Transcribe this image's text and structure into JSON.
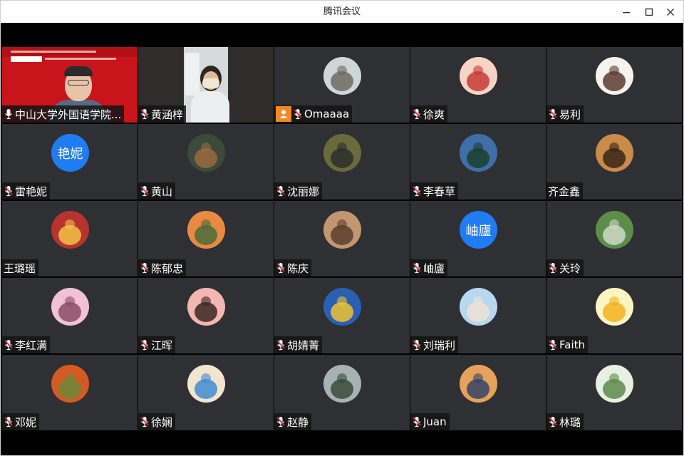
{
  "window": {
    "title": "腾讯会议"
  },
  "participants": [
    {
      "name": "中山大学外国语学院...",
      "type": "video-speaker",
      "muted": false
    },
    {
      "name": "黄涵梓",
      "type": "video-room",
      "muted": true
    },
    {
      "name": "Omaaaa",
      "type": "avatar",
      "muted": true,
      "host": true,
      "avatar_colors": [
        "#cfd6d8",
        "#6c6b5f"
      ]
    },
    {
      "name": "徐爽",
      "type": "avatar",
      "muted": true,
      "avatar_colors": [
        "#f7d4c5",
        "#c73a36"
      ]
    },
    {
      "name": "易利",
      "type": "avatar",
      "muted": true,
      "avatar_colors": [
        "#f6f3ee",
        "#5a3a2f"
      ]
    },
    {
      "name": "雷艳妮",
      "type": "text-avatar",
      "avatar_text": "艳妮",
      "muted": true
    },
    {
      "name": "黄山",
      "type": "avatar",
      "muted": true,
      "avatar_colors": [
        "#3b4a3a",
        "#9a6a3e"
      ]
    },
    {
      "name": "沈丽娜",
      "type": "avatar",
      "muted": true,
      "avatar_colors": [
        "#6b6a3c",
        "#2a2f29"
      ]
    },
    {
      "name": "李春草",
      "type": "avatar",
      "muted": true,
      "avatar_colors": [
        "#3f6ea8",
        "#1b3f2e"
      ]
    },
    {
      "name": "齐金鑫",
      "type": "avatar",
      "muted": false,
      "avatar_colors": [
        "#c98a4a",
        "#3a2417"
      ]
    },
    {
      "name": "王璐瑶",
      "type": "avatar",
      "muted": false,
      "avatar_colors": [
        "#b6332f",
        "#f3c245"
      ]
    },
    {
      "name": "陈郁忠",
      "type": "avatar",
      "muted": true,
      "avatar_colors": [
        "#e98a43",
        "#4a6b3a"
      ]
    },
    {
      "name": "陈庆",
      "type": "avatar",
      "muted": true,
      "avatar_colors": [
        "#c29670",
        "#59402f"
      ]
    },
    {
      "name": "岫廬",
      "type": "text-avatar",
      "avatar_text": "岫廬",
      "muted": true
    },
    {
      "name": "关玲",
      "type": "avatar",
      "muted": true,
      "avatar_colors": [
        "#5c8d4a",
        "#cfd9c8"
      ]
    },
    {
      "name": "李红满",
      "type": "avatar",
      "muted": true,
      "avatar_colors": [
        "#f1c2d3",
        "#8a4d6a"
      ]
    },
    {
      "name": "江晖",
      "type": "avatar",
      "muted": true,
      "avatar_colors": [
        "#f4b6b3",
        "#3a2722"
      ]
    },
    {
      "name": "胡婧菁",
      "type": "avatar",
      "muted": true,
      "avatar_colors": [
        "#2a5fb2",
        "#f0c232"
      ]
    },
    {
      "name": "刘瑞利",
      "type": "avatar",
      "muted": true,
      "avatar_colors": [
        "#b7d8ef",
        "#f1e3d6"
      ]
    },
    {
      "name": "Faith",
      "type": "avatar",
      "muted": true,
      "avatar_colors": [
        "#fff4c2",
        "#f3b21e"
      ]
    },
    {
      "name": "邓妮",
      "type": "avatar",
      "muted": true,
      "avatar_colors": [
        "#d45a23",
        "#6b8a3a"
      ]
    },
    {
      "name": "徐娴",
      "type": "avatar",
      "muted": true,
      "avatar_colors": [
        "#f3e4d0",
        "#3f8cd1"
      ]
    },
    {
      "name": "赵静",
      "type": "avatar",
      "muted": true,
      "avatar_colors": [
        "#a7b2b4",
        "#3a4a3a"
      ]
    },
    {
      "name": "Juan",
      "type": "avatar",
      "muted": true,
      "avatar_colors": [
        "#e6a15a",
        "#33446a"
      ]
    },
    {
      "name": "林璐",
      "type": "avatar",
      "muted": true,
      "avatar_colors": [
        "#e8efe3",
        "#5c8a4a"
      ]
    }
  ],
  "colors": {
    "tile_bg": "#2f3033",
    "text_avatar": "#1f7cf2",
    "host_badge": "#f08a24",
    "muted_icon": "#d7322e"
  }
}
